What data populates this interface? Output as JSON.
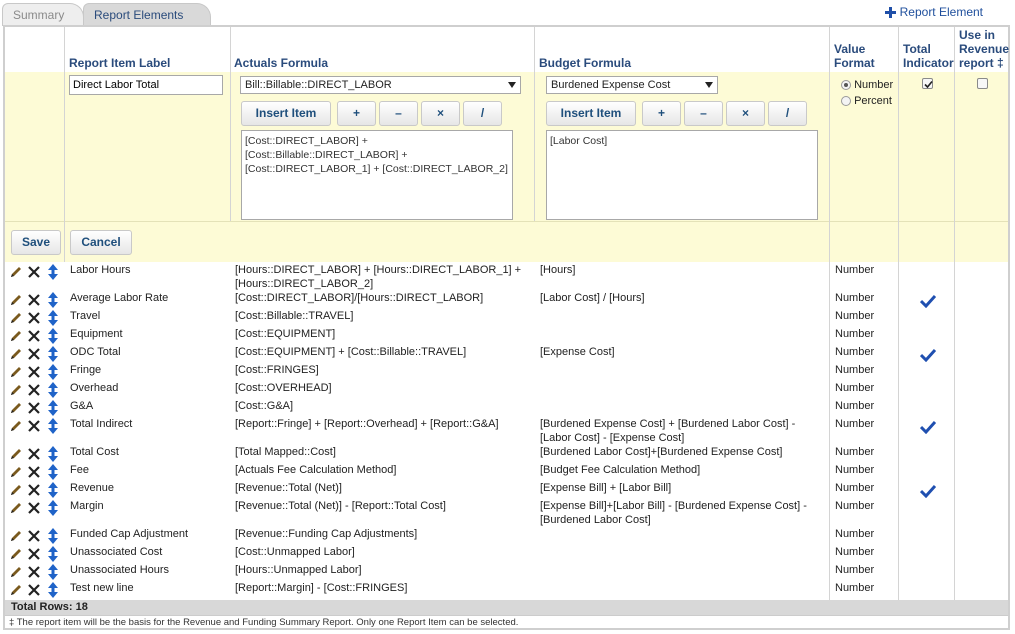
{
  "tabs": [
    {
      "label": "Summary",
      "active": false
    },
    {
      "label": "Report Elements",
      "active": true
    }
  ],
  "add_element_label": "Report Element",
  "columns": {
    "label": "Report Item Label",
    "actuals": "Actuals Formula",
    "budget": "Budget Formula",
    "value_format": "Value Format",
    "total_indicator": "Total Indicator",
    "revenue": "Use in Revenue report ‡"
  },
  "editor": {
    "label_value": "Direct Labor Total",
    "actuals_select": "Bill::Billable::DIRECT_LABOR",
    "budget_select": "Burdened Expense Cost",
    "insert_item": "Insert Item",
    "ops": [
      "+",
      "–",
      "×",
      "/"
    ],
    "actuals_formula": "[Cost::DIRECT_LABOR] +\n[Cost::Billable::DIRECT_LABOR] +\n[Cost::DIRECT_LABOR_1] + [Cost::DIRECT_LABOR_2]",
    "budget_formula": "[Labor Cost]",
    "format_number": "Number",
    "format_percent": "Percent",
    "format_selected": "Number",
    "total_checked": true,
    "revenue_checked": false,
    "save": "Save",
    "cancel": "Cancel"
  },
  "rows": [
    {
      "label": "Labor Hours",
      "actuals": "[Hours::DIRECT_LABOR] + [Hours::DIRECT_LABOR_1] + [Hours::DIRECT_LABOR_2]",
      "budget": "[Hours]",
      "format": "Number",
      "total": false
    },
    {
      "label": "Average Labor Rate",
      "actuals": "[Cost::DIRECT_LABOR]/[Hours::DIRECT_LABOR]",
      "budget": "[Labor Cost] / [Hours]",
      "format": "Number",
      "total": true
    },
    {
      "label": "Travel",
      "actuals": "[Cost::Billable::TRAVEL]",
      "budget": "",
      "format": "Number",
      "total": false
    },
    {
      "label": "Equipment",
      "actuals": "[Cost::EQUIPMENT]",
      "budget": "",
      "format": "Number",
      "total": false
    },
    {
      "label": "ODC Total",
      "actuals": "[Cost::EQUIPMENT] + [Cost::Billable::TRAVEL]",
      "budget": "[Expense Cost]",
      "format": "Number",
      "total": true
    },
    {
      "label": "Fringe",
      "actuals": "[Cost::FRINGES]",
      "budget": "",
      "format": "Number",
      "total": false
    },
    {
      "label": "Overhead",
      "actuals": "[Cost::OVERHEAD]",
      "budget": "",
      "format": "Number",
      "total": false
    },
    {
      "label": "G&A",
      "actuals": "[Cost::G&A]",
      "budget": "",
      "format": "Number",
      "total": false
    },
    {
      "label": "Total Indirect",
      "actuals": "[Report::Fringe] + [Report::Overhead] + [Report::G&A]",
      "budget": "[Burdened Expense Cost] + [Burdened Labor Cost] - [Labor Cost] - [Expense Cost]",
      "format": "Number",
      "total": true
    },
    {
      "label": "Total Cost",
      "actuals": "[Total Mapped::Cost]",
      "budget": "[Burdened Labor Cost]+[Burdened Expense Cost]",
      "format": "Number",
      "total": false
    },
    {
      "label": "Fee",
      "actuals": "[Actuals Fee Calculation Method]",
      "budget": "[Budget Fee Calculation Method]",
      "format": "Number",
      "total": false
    },
    {
      "label": "Revenue",
      "actuals": "[Revenue::Total (Net)]",
      "budget": "[Expense Bill] + [Labor Bill]",
      "format": "Number",
      "total": true
    },
    {
      "label": "Margin",
      "actuals": "[Revenue::Total (Net)] - [Report::Total Cost]",
      "budget": "[Expense Bill]+[Labor Bill] - [Burdened Expense Cost] - [Burdened Labor Cost]",
      "format": "Number",
      "total": false
    },
    {
      "label": "Funded Cap Adjustment",
      "actuals": "[Revenue::Funding Cap Adjustments]",
      "budget": "",
      "format": "Number",
      "total": false
    },
    {
      "label": "Unassociated Cost",
      "actuals": "[Cost::Unmapped Labor]",
      "budget": "",
      "format": "Number",
      "total": false
    },
    {
      "label": "Unassociated Hours",
      "actuals": "[Hours::Unmapped Labor]",
      "budget": "",
      "format": "Number",
      "total": false
    },
    {
      "label": "Test new line",
      "actuals": "[Report::Margin] - [Cost::FRINGES]",
      "budget": "",
      "format": "Number",
      "total": false
    }
  ],
  "total_rows": "Total Rows: 18",
  "footnote": "‡ The report item will be the basis for the Revenue and Funding Summary Report. Only one Report Item can be selected."
}
